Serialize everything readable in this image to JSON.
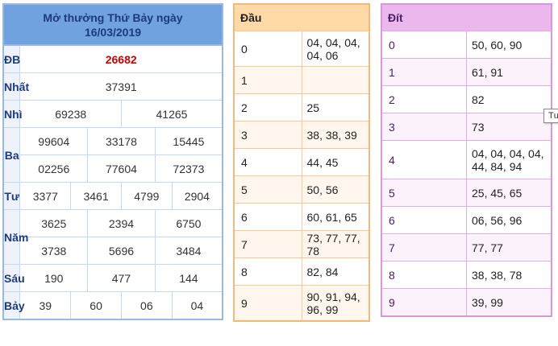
{
  "result": {
    "title_line1": "Mở thưởng Thứ Bảy ngày",
    "title_line2": "16/03/2019",
    "rows": {
      "db": {
        "label": "ĐB",
        "values": [
          "26682"
        ]
      },
      "nhat": {
        "label": "Nhất",
        "values": [
          "37391"
        ]
      },
      "nhi": {
        "label": "Nhì",
        "values": [
          "69238",
          "41265"
        ]
      },
      "ba": {
        "label": "Ba",
        "values": [
          "99604",
          "33178",
          "15445",
          "02256",
          "77604",
          "72373"
        ]
      },
      "tu": {
        "label": "Tư",
        "values": [
          "3377",
          "3461",
          "4799",
          "2904"
        ]
      },
      "nam": {
        "label": "Năm",
        "values": [
          "3625",
          "2394",
          "6750",
          "3738",
          "5696",
          "3484"
        ]
      },
      "sau": {
        "label": "Sáu",
        "values": [
          "190",
          "477",
          "144"
        ]
      },
      "bay": {
        "label": "Bảy",
        "values": [
          "39",
          "60",
          "06",
          "04"
        ]
      }
    }
  },
  "dau": {
    "header": "Đầu",
    "rows": [
      {
        "key": "0",
        "values": "04, 04, 04, 04, 06"
      },
      {
        "key": "1",
        "values": ""
      },
      {
        "key": "2",
        "values": "25"
      },
      {
        "key": "3",
        "values": "38, 38, 39"
      },
      {
        "key": "4",
        "values": "44, 45"
      },
      {
        "key": "5",
        "values": "50, 56"
      },
      {
        "key": "6",
        "values": "60, 61, 65"
      },
      {
        "key": "7",
        "values": "73, 77, 77, 78"
      },
      {
        "key": "8",
        "values": "82, 84"
      },
      {
        "key": "9",
        "values": "90, 91, 94, 96, 99"
      }
    ]
  },
  "dit": {
    "header": "Đít",
    "rows": [
      {
        "key": "0",
        "values": "50, 60, 90"
      },
      {
        "key": "1",
        "values": "61, 91"
      },
      {
        "key": "2",
        "values": "82"
      },
      {
        "key": "3",
        "values": "73"
      },
      {
        "key": "4",
        "values": "04, 04, 04, 04, 44, 84, 94"
      },
      {
        "key": "5",
        "values": "25, 45, 65"
      },
      {
        "key": "6",
        "values": "06, 56, 96"
      },
      {
        "key": "7",
        "values": "77, 77"
      },
      {
        "key": "8",
        "values": "38, 38, 78"
      },
      {
        "key": "9",
        "values": "39, 99"
      }
    ]
  },
  "tooltip": "Tư",
  "colors": {
    "special_prize": "#d10000",
    "result_header": "#6fa2df",
    "dau_header": "#ffd9a6",
    "dit_header": "#ecb7ec"
  }
}
